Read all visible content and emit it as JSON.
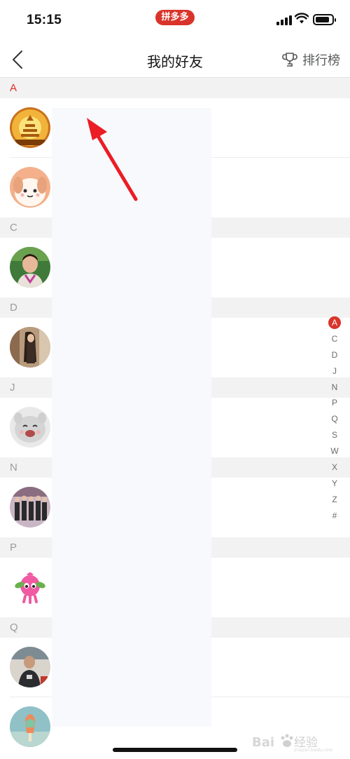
{
  "status_bar": {
    "time": "15:15",
    "app_badge": "拼多多"
  },
  "nav": {
    "title": "我的好友",
    "ranking_label": "排行榜"
  },
  "sections": [
    {
      "letter": "A",
      "count": 2
    },
    {
      "letter": "C",
      "count": 1
    },
    {
      "letter": "D",
      "count": 1
    },
    {
      "letter": "J",
      "count": 1
    },
    {
      "letter": "N",
      "count": 1
    },
    {
      "letter": "P",
      "count": 1
    },
    {
      "letter": "Q",
      "count": 2
    }
  ],
  "alphabet_index": [
    "A",
    "C",
    "D",
    "J",
    "N",
    "P",
    "Q",
    "S",
    "W",
    "X",
    "Y",
    "Z",
    "#"
  ],
  "active_index": "A",
  "watermark": {
    "logo": "Bai经验",
    "url": "jingyan.baidu.com"
  },
  "colors": {
    "accent": "#e02e24",
    "header_bg": "#f2f2f2",
    "redaction": "#f8f9fc"
  }
}
